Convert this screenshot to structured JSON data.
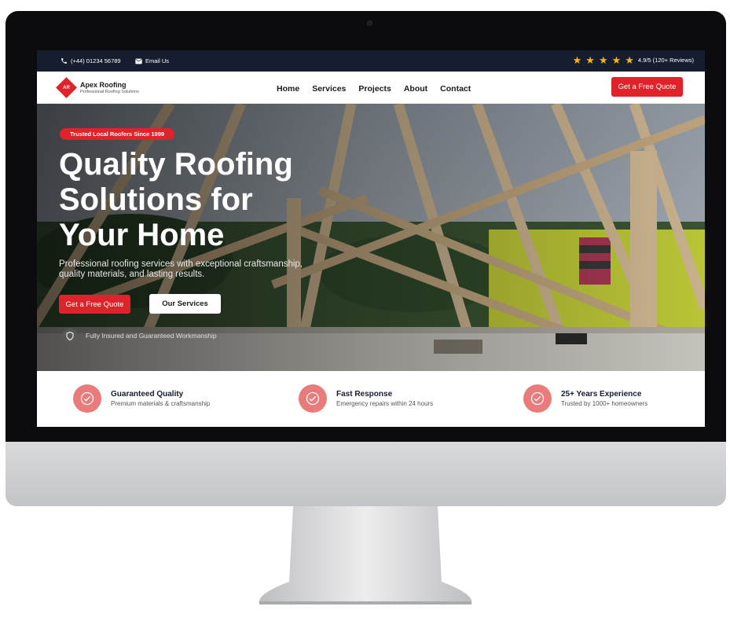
{
  "topbar": {
    "phone": "(+44) 01234 56789",
    "email": "Email Us",
    "rating_text": "4.9/5 (120+ Reviews)",
    "stars": 5
  },
  "brand": {
    "initials": "AR",
    "name": "Apex Roofing",
    "tagline": "Professional Roofing Solutions"
  },
  "nav": {
    "items": [
      "Home",
      "Services",
      "Projects",
      "About",
      "Contact"
    ],
    "cta": "Get a Free Quote"
  },
  "hero": {
    "badge": "Trusted Local Roofers Since 1999",
    "title_lines": [
      "Quality Roofing",
      "Solutions for",
      "Your Home"
    ],
    "subtitle_lines": [
      "Professional roofing services with exceptional craftsmanship,",
      "quality materials, and lasting results."
    ],
    "primary_button": "Get a Free Quote",
    "secondary_button": "Our Services",
    "insured_text": "Fully Insured and Guaranteed Workmanship"
  },
  "features": [
    {
      "title": "Guaranteed Quality",
      "subtitle": "Premium materials & craftsmanship"
    },
    {
      "title": "Fast Response",
      "subtitle": "Emergency repairs within 24 hours"
    },
    {
      "title": "25+ Years Experience",
      "subtitle": "Trusted by 1000+ homeowners"
    }
  ],
  "colors": {
    "accent": "#e0222b",
    "topbar": "#151d2f",
    "feature_icon_bg": "#ea7b7d"
  },
  "icons": {
    "phone": "phone-icon",
    "email": "envelope-icon",
    "star": "star-icon",
    "shield": "shield-icon",
    "check": "check-circle-icon"
  }
}
